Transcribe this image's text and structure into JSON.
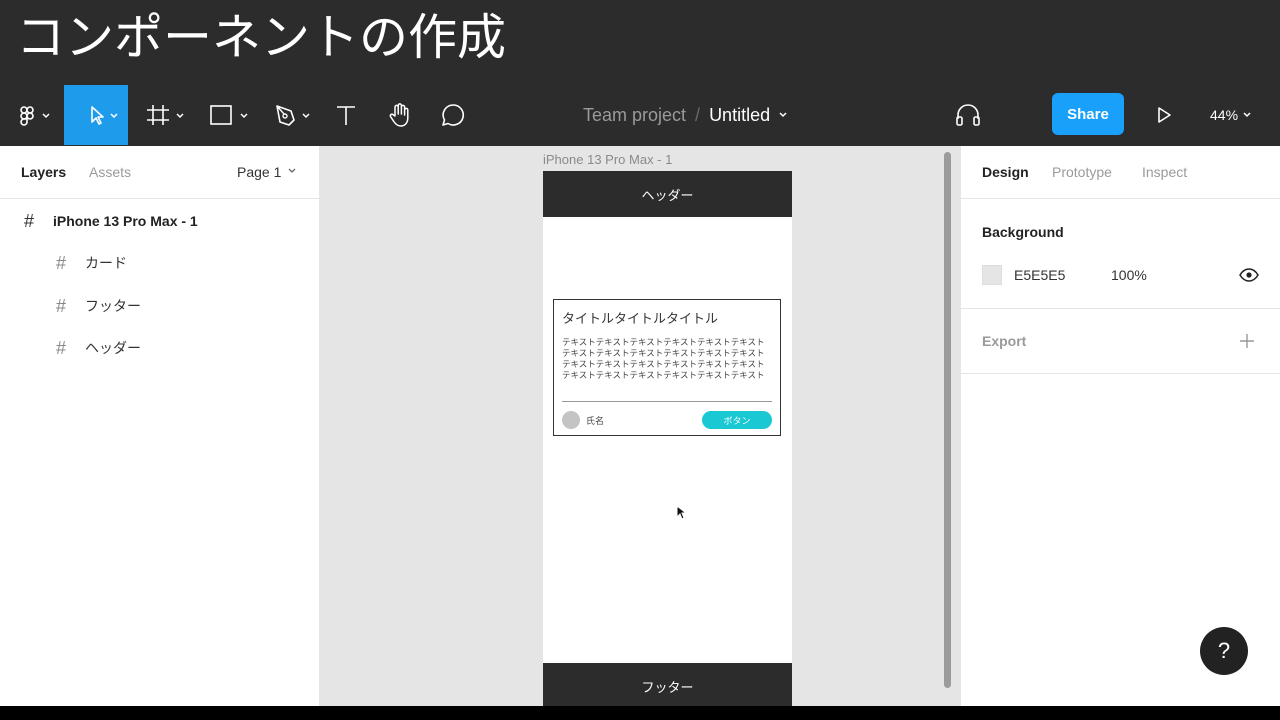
{
  "banner": {
    "title": "コンポーネントの作成"
  },
  "toolbar": {
    "breadcrumb_team": "Team project",
    "breadcrumb_sep": "/",
    "file_name": "Untitled",
    "share_label": "Share",
    "zoom": "44%"
  },
  "left_panel": {
    "tabs": [
      "Layers",
      "Assets"
    ],
    "page": "Page 1",
    "layers": [
      {
        "name": "iPhone 13 Pro Max - 1"
      },
      {
        "name": "カード"
      },
      {
        "name": "フッター"
      },
      {
        "name": "ヘッダー"
      }
    ]
  },
  "canvas": {
    "frame_label": "iPhone 13 Pro Max - 1",
    "header_text": "ヘッダー",
    "footer_text": "フッター",
    "card": {
      "title": "タイトルタイトルタイトル",
      "body": "テキストテキストテキストテキストテキストテキストテキストテキストテキストテキストテキストテキストテキストテキストテキストテキストテキストテキストテキストテキストテキストテキストテキストテキスト",
      "name": "氏名",
      "button": "ボタン"
    }
  },
  "right_panel": {
    "tabs": [
      "Design",
      "Prototype",
      "Inspect"
    ],
    "background_label": "Background",
    "bg_color_hex": "E5E5E5",
    "bg_opacity": "100%",
    "export_label": "Export"
  },
  "help": {
    "label": "?"
  },
  "colors": {
    "accent": "#18a0fb",
    "toolbar": "#2c2c2c",
    "card_button": "#19c8d2"
  }
}
